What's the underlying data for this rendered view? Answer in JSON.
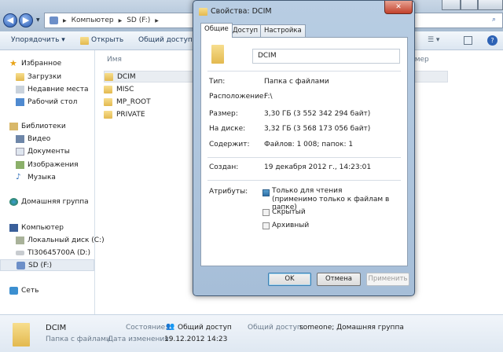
{
  "explorer": {
    "breadcrumb": [
      "Компьютер",
      "SD (F:)"
    ],
    "toolbar": {
      "organize": "Упорядочить ▾",
      "open": "Открыть",
      "share": "Общий доступ ▾"
    },
    "column_name": "Имя",
    "column_size": "Размер",
    "nav": {
      "favorites": "Избранное",
      "downloads": "Загрузки",
      "recent": "Недавние места",
      "desktop": "Рабочий стол",
      "libraries": "Библиотеки",
      "video": "Видео",
      "documents": "Документы",
      "images": "Изображения",
      "music": "Музыка",
      "homegroup": "Домашняя группа",
      "computer": "Компьютер",
      "disk_c": "Локальный диск (C:)",
      "disk_d": "TI30645700A (D:)",
      "disk_f": "SD (F:)",
      "network": "Сеть"
    },
    "files": [
      "DCIM",
      "MISC",
      "MP_ROOT",
      "PRIVATE"
    ],
    "status": {
      "name": "DCIM",
      "type": "Папка с файлами",
      "state_label": "Состояние:",
      "state_value": "Общий доступ",
      "modified_label": "Дата изменения:",
      "modified_value": "19.12.2012 14:23",
      "shared_label": "Общий доступ:",
      "shared_value": "someone; Домашняя группа"
    }
  },
  "dialog": {
    "title": "Свойства: DCIM",
    "close": "✕",
    "tabs": [
      "Общие",
      "Доступ",
      "Настройка"
    ],
    "name": "DCIM",
    "rows": [
      {
        "label": "Тип:",
        "value": "Папка с файлами"
      },
      {
        "label": "Расположение:",
        "value": "F:\\"
      },
      {
        "label": "Размер:",
        "value": "3,30 ГБ (3 552 342 294 байт)"
      },
      {
        "label": "На диске:",
        "value": "3,32 ГБ (3 568 173 056 байт)"
      },
      {
        "label": "Содержит:",
        "value": "Файлов: 1 008; папок: 1"
      }
    ],
    "created_label": "Создан:",
    "created_value": "19 декабря 2012 г., 14:23:01",
    "attributes_label": "Атрибуты:",
    "readonly": "Только для чтения",
    "readonly_note": "(применимо только к файлам в папке)",
    "hidden": "Скрытый",
    "archive": "Архивный",
    "ok": "OK",
    "cancel": "Отмена",
    "apply": "Применить"
  }
}
